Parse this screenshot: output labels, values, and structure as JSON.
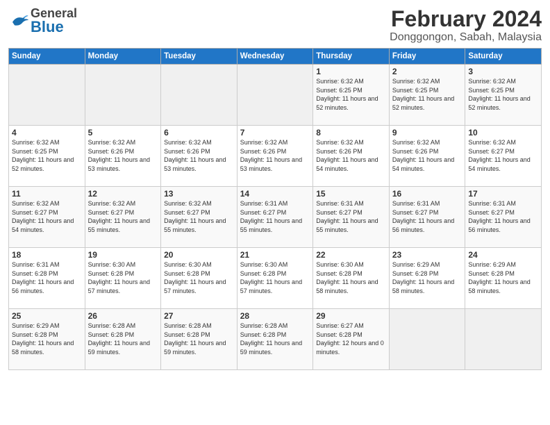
{
  "header": {
    "logo_general": "General",
    "logo_blue": "Blue",
    "title": "February 2024",
    "subtitle": "Donggongon, Sabah, Malaysia"
  },
  "days_of_week": [
    "Sunday",
    "Monday",
    "Tuesday",
    "Wednesday",
    "Thursday",
    "Friday",
    "Saturday"
  ],
  "weeks": [
    [
      {
        "day": "",
        "info": ""
      },
      {
        "day": "",
        "info": ""
      },
      {
        "day": "",
        "info": ""
      },
      {
        "day": "",
        "info": ""
      },
      {
        "day": "1",
        "info": "Sunrise: 6:32 AM\nSunset: 6:25 PM\nDaylight: 11 hours\nand 52 minutes."
      },
      {
        "day": "2",
        "info": "Sunrise: 6:32 AM\nSunset: 6:25 PM\nDaylight: 11 hours\nand 52 minutes."
      },
      {
        "day": "3",
        "info": "Sunrise: 6:32 AM\nSunset: 6:25 PM\nDaylight: 11 hours\nand 52 minutes."
      }
    ],
    [
      {
        "day": "4",
        "info": "Sunrise: 6:32 AM\nSunset: 6:25 PM\nDaylight: 11 hours\nand 52 minutes."
      },
      {
        "day": "5",
        "info": "Sunrise: 6:32 AM\nSunset: 6:26 PM\nDaylight: 11 hours\nand 53 minutes."
      },
      {
        "day": "6",
        "info": "Sunrise: 6:32 AM\nSunset: 6:26 PM\nDaylight: 11 hours\nand 53 minutes."
      },
      {
        "day": "7",
        "info": "Sunrise: 6:32 AM\nSunset: 6:26 PM\nDaylight: 11 hours\nand 53 minutes."
      },
      {
        "day": "8",
        "info": "Sunrise: 6:32 AM\nSunset: 6:26 PM\nDaylight: 11 hours\nand 54 minutes."
      },
      {
        "day": "9",
        "info": "Sunrise: 6:32 AM\nSunset: 6:26 PM\nDaylight: 11 hours\nand 54 minutes."
      },
      {
        "day": "10",
        "info": "Sunrise: 6:32 AM\nSunset: 6:27 PM\nDaylight: 11 hours\nand 54 minutes."
      }
    ],
    [
      {
        "day": "11",
        "info": "Sunrise: 6:32 AM\nSunset: 6:27 PM\nDaylight: 11 hours\nand 54 minutes."
      },
      {
        "day": "12",
        "info": "Sunrise: 6:32 AM\nSunset: 6:27 PM\nDaylight: 11 hours\nand 55 minutes."
      },
      {
        "day": "13",
        "info": "Sunrise: 6:32 AM\nSunset: 6:27 PM\nDaylight: 11 hours\nand 55 minutes."
      },
      {
        "day": "14",
        "info": "Sunrise: 6:31 AM\nSunset: 6:27 PM\nDaylight: 11 hours\nand 55 minutes."
      },
      {
        "day": "15",
        "info": "Sunrise: 6:31 AM\nSunset: 6:27 PM\nDaylight: 11 hours\nand 55 minutes."
      },
      {
        "day": "16",
        "info": "Sunrise: 6:31 AM\nSunset: 6:27 PM\nDaylight: 11 hours\nand 56 minutes."
      },
      {
        "day": "17",
        "info": "Sunrise: 6:31 AM\nSunset: 6:27 PM\nDaylight: 11 hours\nand 56 minutes."
      }
    ],
    [
      {
        "day": "18",
        "info": "Sunrise: 6:31 AM\nSunset: 6:28 PM\nDaylight: 11 hours\nand 56 minutes."
      },
      {
        "day": "19",
        "info": "Sunrise: 6:30 AM\nSunset: 6:28 PM\nDaylight: 11 hours\nand 57 minutes."
      },
      {
        "day": "20",
        "info": "Sunrise: 6:30 AM\nSunset: 6:28 PM\nDaylight: 11 hours\nand 57 minutes."
      },
      {
        "day": "21",
        "info": "Sunrise: 6:30 AM\nSunset: 6:28 PM\nDaylight: 11 hours\nand 57 minutes."
      },
      {
        "day": "22",
        "info": "Sunrise: 6:30 AM\nSunset: 6:28 PM\nDaylight: 11 hours\nand 58 minutes."
      },
      {
        "day": "23",
        "info": "Sunrise: 6:29 AM\nSunset: 6:28 PM\nDaylight: 11 hours\nand 58 minutes."
      },
      {
        "day": "24",
        "info": "Sunrise: 6:29 AM\nSunset: 6:28 PM\nDaylight: 11 hours\nand 58 minutes."
      }
    ],
    [
      {
        "day": "25",
        "info": "Sunrise: 6:29 AM\nSunset: 6:28 PM\nDaylight: 11 hours\nand 58 minutes."
      },
      {
        "day": "26",
        "info": "Sunrise: 6:28 AM\nSunset: 6:28 PM\nDaylight: 11 hours\nand 59 minutes."
      },
      {
        "day": "27",
        "info": "Sunrise: 6:28 AM\nSunset: 6:28 PM\nDaylight: 11 hours\nand 59 minutes."
      },
      {
        "day": "28",
        "info": "Sunrise: 6:28 AM\nSunset: 6:28 PM\nDaylight: 11 hours\nand 59 minutes."
      },
      {
        "day": "29",
        "info": "Sunrise: 6:27 AM\nSunset: 6:28 PM\nDaylight: 12 hours\nand 0 minutes."
      },
      {
        "day": "",
        "info": ""
      },
      {
        "day": "",
        "info": ""
      }
    ]
  ]
}
